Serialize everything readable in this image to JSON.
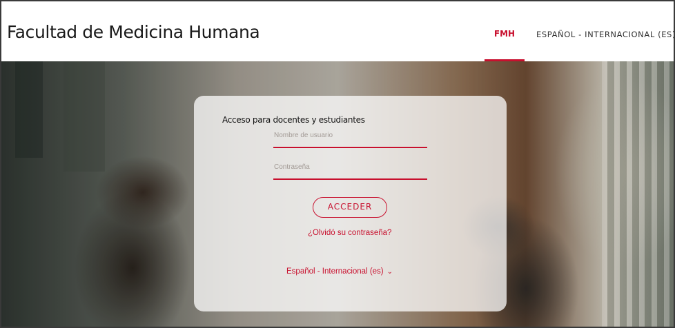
{
  "header": {
    "site_title": "Facultad de Medicina Humana",
    "nav": {
      "fmh": "FMH",
      "language": "ESPAÑOL - INTERNACIONAL (ES)",
      "language_caret": "▢"
    }
  },
  "login": {
    "title": "Acceso para docentes y estudiantes",
    "username_placeholder": "Nombre de usuario",
    "password_placeholder": "Contraseña",
    "submit_label": "ACCEDER",
    "forgot_label": "¿Olvidó su contraseña?",
    "language_select": "Español - Internacional (es)",
    "language_chevron": "⌄"
  },
  "colors": {
    "accent": "#c8102e",
    "header_bg": "#ffffff",
    "text": "#1a1a1a"
  }
}
